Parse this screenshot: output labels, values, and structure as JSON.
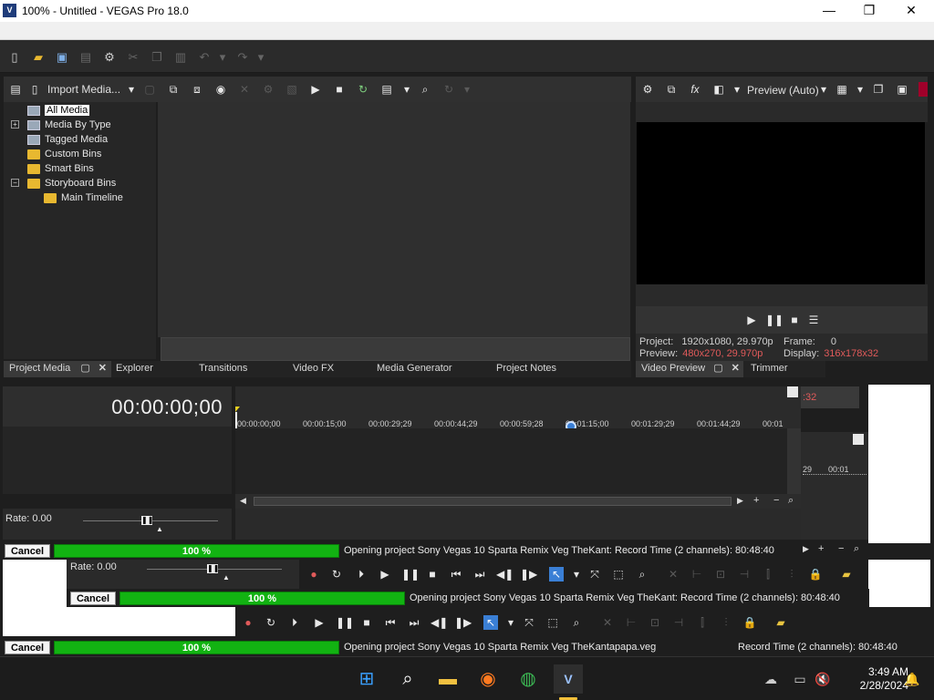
{
  "window": {
    "title": "100% - Untitled - VEGAS Pro 18.0",
    "app_icon_letter": "V",
    "minimize_glyph": "—",
    "maximize_glyph": "❐",
    "close_glyph": "✕"
  },
  "project_media": {
    "import_label": "Import Media...",
    "tree": [
      {
        "label": "All Media",
        "icon": "media-bin-icon",
        "selected": true
      },
      {
        "label": "Media By Type",
        "icon": "media-bin-icon",
        "expander": "+"
      },
      {
        "label": "Tagged Media",
        "icon": "media-bin-icon"
      },
      {
        "label": "Custom Bins",
        "icon": "folder-icon"
      },
      {
        "label": "Smart Bins",
        "icon": "folder-icon"
      },
      {
        "label": "Storyboard Bins",
        "icon": "folder-icon",
        "expander": "−"
      },
      {
        "label": "Main Timeline",
        "icon": "folder-icon",
        "indent": true
      }
    ]
  },
  "tabs": {
    "project_media": "Project Media",
    "explorer": "Explorer",
    "transitions": "Transitions",
    "video_fx": "Video FX",
    "media_generator": "Media Generator",
    "project_notes": "Project Notes",
    "video_preview": "Video Preview",
    "trimmer": "Trimmer"
  },
  "video_preview": {
    "mode": "Preview (Auto)",
    "project_label": "Project:",
    "project_value": "1920x1080, 29.970p",
    "preview_label": "Preview:",
    "preview_value": "480x270, 29.970p",
    "frame_label": "Frame:",
    "frame_value": "0",
    "display_label": "Display:",
    "display_value": "316x178x32",
    "ghost_text": ":32"
  },
  "timeline": {
    "timecode": "00:00:00;00",
    "ruler_labels": [
      "00:00:00;00",
      "00:00:15;00",
      "00:00:29;29",
      "00:00:44;29",
      "00:00:59;28",
      "00:01:15;00",
      "00:01:29;29",
      "00:01:44;29",
      "00:01"
    ],
    "ghost_ruler_label": "29",
    "ghost_ruler_label2": "00:01",
    "rate_label": "Rate: 0.00"
  },
  "progress": {
    "cancel_label": "Cancel",
    "percent_label": "100 %",
    "percent_value": 100,
    "message_short": "Opening project Sony Vegas 10 Sparta Remix Veg TheKant:",
    "message_full": "Opening project Sony Vegas 10 Sparta Remix Veg TheKantapapa.veg",
    "record_time": "Record Time (2 channels): 80:48:40"
  },
  "taskbar": {
    "time": "3:49 AM",
    "date": "2/28/2024"
  }
}
